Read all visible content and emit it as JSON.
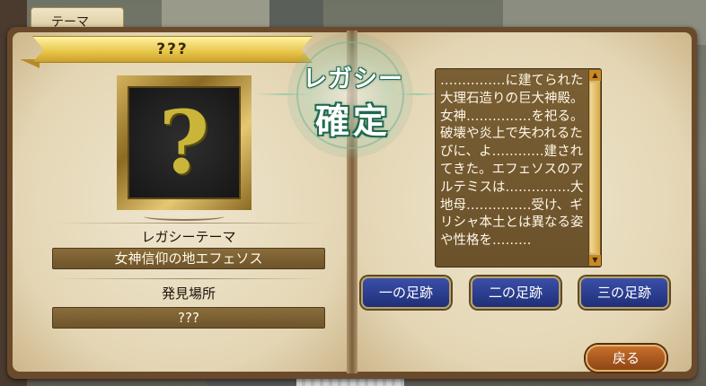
{
  "window": {
    "tab_label": "テーマ"
  },
  "theme": {
    "title": "???",
    "image_symbol": "?",
    "legacy_theme_label": "レガシーテーマ",
    "legacy_theme_value": "女神信仰の地エフェソス",
    "discovery_label": "発見場所",
    "discovery_value": "???"
  },
  "stamp": {
    "line1": "レガシー",
    "line2": "確定"
  },
  "description": {
    "text": "……………に建てられた大理石造りの巨大神殿。女神……………を祀る。破壊や炎上で失われるたびに、よ…………建されてきた。エフェソスのアルテミスは……………大地母……………受け、ギリシャ本土とは異なる姿や性格を………"
  },
  "footprints": {
    "first": "一の足跡",
    "second": "二の足跡",
    "third": "三の足跡"
  },
  "buttons": {
    "back": "戻る"
  },
  "icons": {
    "scroll_up": "triangle-up-icon",
    "scroll_down": "triangle-down-icon"
  }
}
